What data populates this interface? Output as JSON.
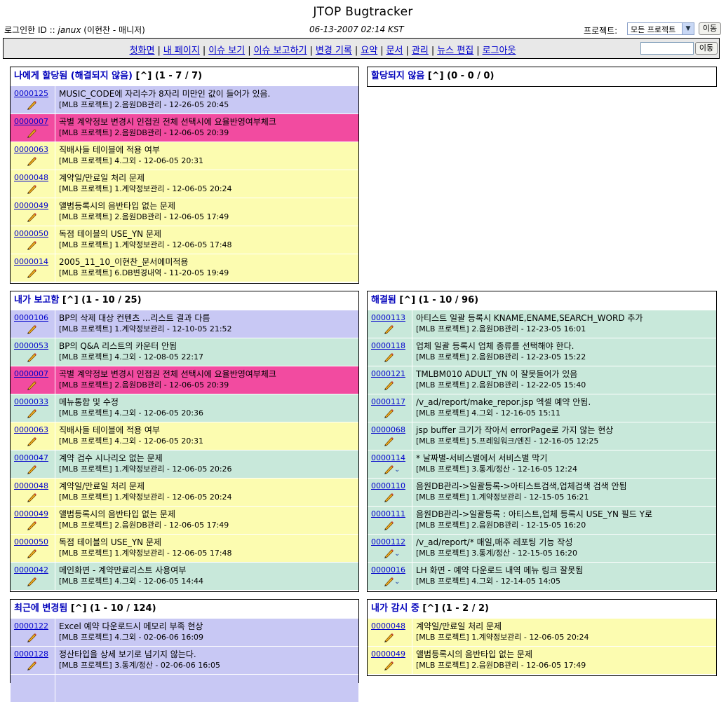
{
  "app": {
    "title": "JTOP Bugtracker",
    "login_prefix": "로그인한 ID :: ",
    "login_user": "janux",
    "login_suffix": " (이현찬 - 매니저)",
    "datetime": "06-13-2007 02:14 KST",
    "project_label": "프로젝트:",
    "project_selected": "모든 프로젝트",
    "move_button": "이동"
  },
  "nav": {
    "links": [
      "첫화면",
      "내 페이지",
      "이슈 보기",
      "이슈 보고하기",
      "변경 기록",
      "요약",
      "문서",
      "관리",
      "뉴스 편집",
      "로그아웃"
    ],
    "search_value": "",
    "go_button": "이동"
  },
  "colors": {
    "new": "#c8c8f4",
    "feedback": "#f24ba0",
    "assigned": "#fcfcb0",
    "resolved": "#c8e8da"
  },
  "panels": {
    "assigned": {
      "title": "나에게 할당됨 (해결되지 않음)",
      "link": "[^]",
      "count": "(1 - 7 / 7)",
      "rows": [
        {
          "id": "0000125",
          "summary": "MUSIC_CODE에 자리수가 8자리 미만인 값이 들어가 있음.",
          "meta": "[MLB 프로젝트] 2.음원DB관리 - 12-26-05 20:45",
          "color": "new"
        },
        {
          "id": "0000007",
          "summary": "곡별 계약정보 변경시 인접권 전체 선택시에 요율반영여부체크",
          "meta": "[MLB 프로젝트] 2.음원DB관리 - 12-06-05 20:39",
          "color": "feedback"
        },
        {
          "id": "0000063",
          "summary": "직배사들 테이블에 적용 여부",
          "meta": "[MLB 프로젝트] 4.그외 - 12-06-05 20:31",
          "color": "assigned"
        },
        {
          "id": "0000048",
          "summary": "계약일/만료일 처리 문제",
          "meta": "[MLB 프로젝트] 1.계약정보관리 - 12-06-05 20:24",
          "color": "assigned"
        },
        {
          "id": "0000049",
          "summary": "앨범등록시의 음반타입 없는 문제",
          "meta": "[MLB 프로젝트] 2.음원DB관리 - 12-06-05 17:49",
          "color": "assigned"
        },
        {
          "id": "0000050",
          "summary": "독점 테이블의 USE_YN 문제",
          "meta": "[MLB 프로젝트] 1.계약정보관리 - 12-06-05 17:48",
          "color": "assigned"
        },
        {
          "id": "0000014",
          "summary": "2005_11_10_이현찬_문서에미적용",
          "meta": "[MLB 프로젝트] 6.DB변경내역 - 11-20-05 19:49",
          "color": "assigned"
        }
      ]
    },
    "unassigned": {
      "title": "할당되지 않음",
      "link": "[^]",
      "count": "(0 - 0 / 0)",
      "rows": []
    },
    "reported": {
      "title": "내가 보고함",
      "link": "[^]",
      "count": "(1 - 10 / 25)",
      "rows": [
        {
          "id": "0000106",
          "summary": "BP의 삭제 대상 컨텐츠 ...리스트 결과 다름",
          "meta": "[MLB 프로젝트] 1.계약정보관리 - 12-10-05 21:52",
          "color": "new"
        },
        {
          "id": "0000053",
          "summary": "BP의 Q&A 리스트의 카운터 안됨",
          "meta": "[MLB 프로젝트] 4.그외 - 12-08-05 22:17",
          "color": "resolved"
        },
        {
          "id": "0000007",
          "summary": "곡별 계약정보 변경시 인접권 전체 선택시에 요율반영여부체크",
          "meta": "[MLB 프로젝트] 2.음원DB관리 - 12-06-05 20:39",
          "color": "feedback"
        },
        {
          "id": "0000033",
          "summary": "메뉴통합 및 수정",
          "meta": "[MLB 프로젝트] 4.그외 - 12-06-05 20:36",
          "color": "resolved"
        },
        {
          "id": "0000063",
          "summary": "직배사들 테이블에 적용 여부",
          "meta": "[MLB 프로젝트] 4.그외 - 12-06-05 20:31",
          "color": "assigned"
        },
        {
          "id": "0000047",
          "summary": "계약 검수 시나리오 없는 문제",
          "meta": "[MLB 프로젝트] 1.계약정보관리 - 12-06-05 20:26",
          "color": "resolved"
        },
        {
          "id": "0000048",
          "summary": "계약일/만료일 처리 문제",
          "meta": "[MLB 프로젝트] 1.계약정보관리 - 12-06-05 20:24",
          "color": "assigned"
        },
        {
          "id": "0000049",
          "summary": "앨범등록시의 음반타입 없는 문제",
          "meta": "[MLB 프로젝트] 2.음원DB관리 - 12-06-05 17:49",
          "color": "assigned"
        },
        {
          "id": "0000050",
          "summary": "독점 테이블의 USE_YN 문제",
          "meta": "[MLB 프로젝트] 1.계약정보관리 - 12-06-05 17:48",
          "color": "assigned"
        },
        {
          "id": "0000042",
          "summary": "메인화면 - 계약만료리스트 사용여부",
          "meta": "[MLB 프로젝트] 4.그외 - 12-06-05 14:44",
          "color": "resolved"
        }
      ]
    },
    "resolved": {
      "title": "해결됨",
      "link": "[^]",
      "count": "(1 - 10 / 96)",
      "rows": [
        {
          "id": "0000113",
          "summary": "아티스트 일괄 등록시 KNAME,ENAME,SEARCH_WORD 추가",
          "meta": "[MLB 프로젝트] 2.음원DB관리 - 12-23-05 16:01",
          "color": "resolved"
        },
        {
          "id": "0000118",
          "summary": "업체 일괄 등록시 업체 종류를 선택해야 한다.",
          "meta": "[MLB 프로젝트] 2.음원DB관리 - 12-23-05 15:22",
          "color": "resolved"
        },
        {
          "id": "0000121",
          "summary": "TMLBM010 ADULT_YN 이 잘못들어가 있음",
          "meta": "[MLB 프로젝트] 2.음원DB관리 - 12-22-05 15:40",
          "color": "resolved"
        },
        {
          "id": "0000117",
          "summary": "/v_ad/report/make_repor.jsp 엑셀 예약 안됨.",
          "meta": "[MLB 프로젝트] 4.그외 - 12-16-05 15:11",
          "color": "resolved"
        },
        {
          "id": "0000068",
          "summary": "jsp buffer 크기가 작아서 errorPage로 가지 않는 현상",
          "meta": "[MLB 프로젝트] 5.프레임워크/엔진 - 12-16-05 12:25",
          "color": "resolved"
        },
        {
          "id": "0000114",
          "summary": "* 날짜별-서비스별에서 서비스별 막기",
          "meta": "[MLB 프로젝트] 3.통계/정산 - 12-16-05 12:24",
          "color": "resolved",
          "chev": true
        },
        {
          "id": "0000110",
          "summary": "음원DB관리->일괄등록->아티스트검색,업체검색 검색 안됨",
          "meta": "[MLB 프로젝트] 1.계약정보관리 - 12-15-05 16:21",
          "color": "resolved"
        },
        {
          "id": "0000111",
          "summary": "음원DB관리->일괄등록 : 아티스트,업체 등록시 USE_YN 필드 Y로",
          "meta": "[MLB 프로젝트] 2.음원DB관리 - 12-15-05 16:20",
          "color": "resolved"
        },
        {
          "id": "0000112",
          "summary": "/v_ad/report/* 매일,매주 레포팅 기능 작성",
          "meta": "[MLB 프로젝트] 3.통계/정산 - 12-15-05 16:20",
          "color": "resolved",
          "chev": true
        },
        {
          "id": "0000016",
          "summary": "LH 화면 - 예약 다운로드 내역 메뉴 링크 잘못됨",
          "meta": "[MLB 프로젝트] 4.그외 - 12-14-05 14:05",
          "color": "resolved",
          "chev": true
        }
      ]
    },
    "recent": {
      "title": "최근에 변경됨",
      "link": "[^]",
      "count": "(1 - 10 / 124)",
      "rows": [
        {
          "id": "0000122",
          "summary": "Excel 예약 다운로드시 메모리 부족 현상",
          "meta": "[MLB 프로젝트] 4.그외 - 02-06-06 16:09",
          "color": "new"
        },
        {
          "id": "0000128",
          "summary": "정산타입을 상세 보기로 넘기지 않는다.",
          "meta": "[MLB 프로젝트] 3.통계/정산 - 02-06-06 16:05",
          "color": "new"
        },
        {
          "id": "",
          "summary": "",
          "meta": "",
          "color": "new"
        }
      ]
    },
    "monitoring": {
      "title": "내가 감시 중",
      "link": "[^]",
      "count": "(1 - 2 / 2)",
      "rows": [
        {
          "id": "0000048",
          "summary": "계약일/만료일 처리 문제",
          "meta": "[MLB 프로젝트] 1.계약정보관리 - 12-06-05 20:24",
          "color": "assigned"
        },
        {
          "id": "0000049",
          "summary": "앨범등록시의 음반타입 없는 문제",
          "meta": "[MLB 프로젝트] 2.음원DB관리 - 12-06-05 17:49",
          "color": "assigned"
        }
      ]
    }
  }
}
